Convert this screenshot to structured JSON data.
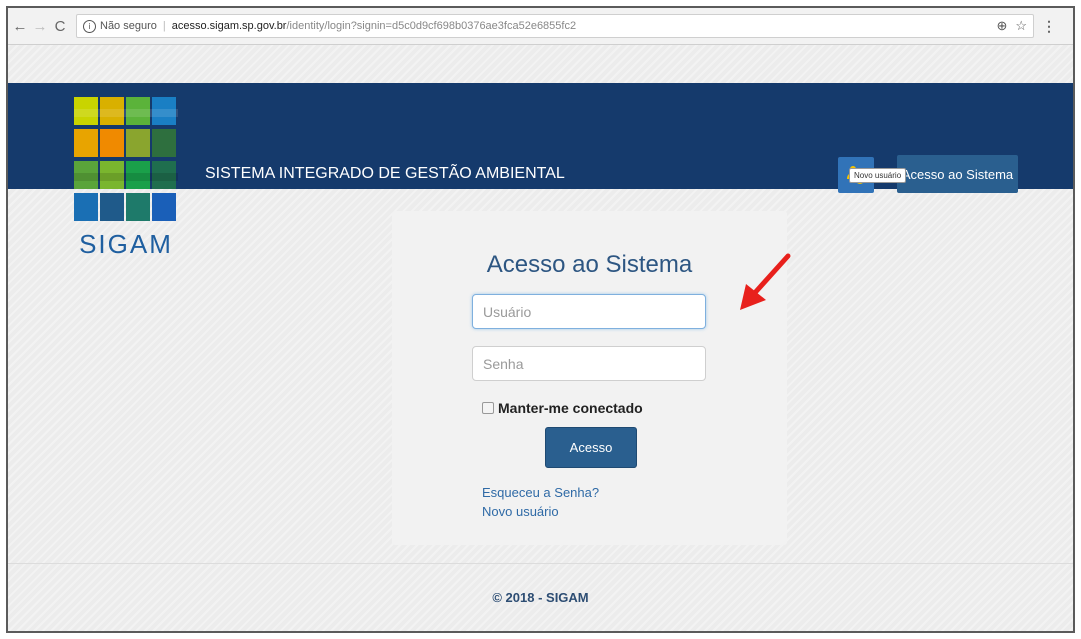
{
  "browser": {
    "not_secure": "Não seguro",
    "url_host": "acesso.sigam.sp.gov.br",
    "url_path": "/identity/login?signin=d5c0d9cf698b0376ae3fca52e6855fc2"
  },
  "header": {
    "logo_text": "SIGAM",
    "title": "SISTEMA INTEGRADO DE GESTÃO AMBIENTAL",
    "new_user_tooltip": "Novo usuário",
    "access_button": "Acesso ao Sistema"
  },
  "login": {
    "title": "Acesso ao Sistema",
    "username_placeholder": "Usuário",
    "password_placeholder": "Senha",
    "remember_label": "Manter-me conectado",
    "submit_label": "Acesso",
    "forgot_link": "Esqueceu a Senha?",
    "new_user_link": "Novo usuário"
  },
  "footer": {
    "text": "© 2018 - SIGAM"
  },
  "colors": {
    "header_bg": "#153a6c",
    "button_bg": "#2a5f8f",
    "arrow": "#e8201c"
  }
}
